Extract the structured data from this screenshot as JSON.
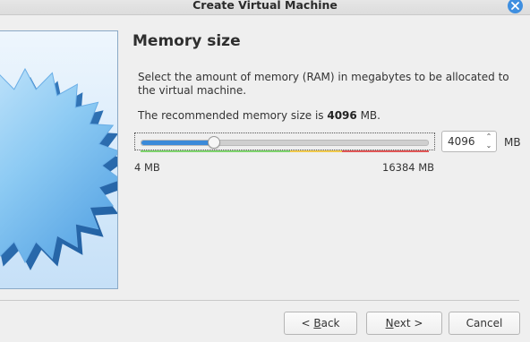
{
  "window": {
    "title": "Create Virtual Machine",
    "close_icon": "close-icon"
  },
  "page": {
    "heading": "Memory size",
    "description": "Select the amount of memory (RAM) in megabytes to be allocated to the virtual machine.",
    "recommended_prefix": "The recommended memory size is ",
    "recommended_value": "4096",
    "recommended_suffix": " MB."
  },
  "memory": {
    "value": "4096",
    "unit": "MB",
    "min_label": "4 MB",
    "max_label": "16384 MB",
    "min": 4,
    "max": 16384,
    "current": 4096,
    "accent_color": "#3b8ad9",
    "safe_zone_color": "#7ed36d",
    "warning_zone_color": "#f0c94c",
    "danger_zone_color": "#e05656"
  },
  "footer": {
    "back_prefix": "< ",
    "back_accel": "B",
    "back_rest": "ack",
    "next_accel": "N",
    "next_rest": "ext >",
    "cancel_label": "Cancel"
  }
}
